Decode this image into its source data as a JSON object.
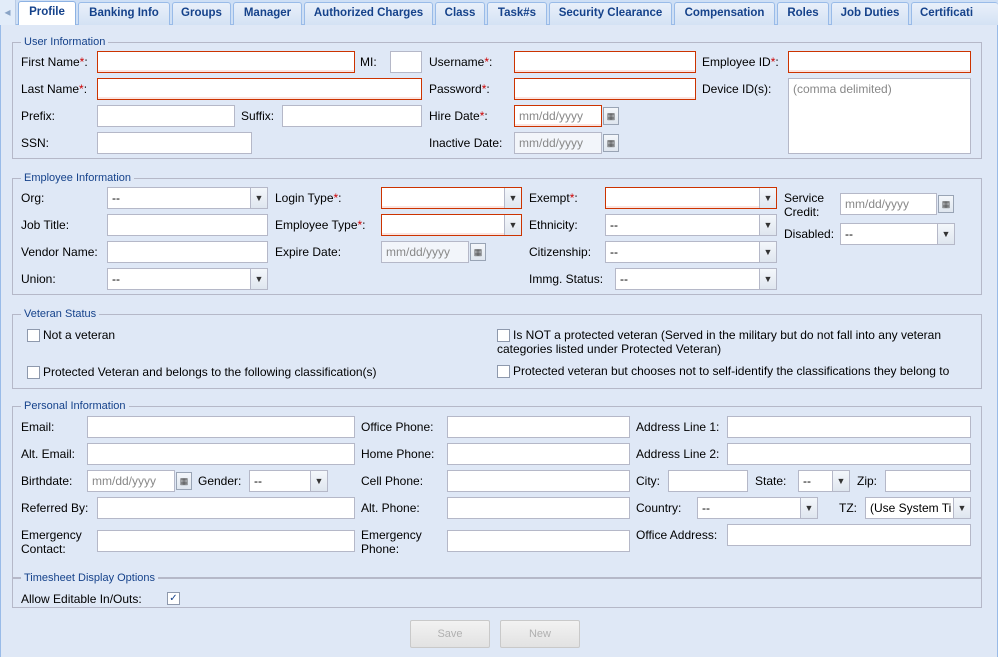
{
  "tabs": [
    "Profile",
    "Banking Info",
    "Groups",
    "Manager",
    "Authorized Charges",
    "Class",
    "Task#s",
    "Security Clearance",
    "Compensation",
    "Roles",
    "Job Duties",
    "Certificati"
  ],
  "user_info": {
    "legend": "User Information",
    "first_name": "First Name",
    "mi": "MI:",
    "username": "Username",
    "employee_id": "Employee ID",
    "last_name": "Last Name",
    "password": "Password",
    "device_ids": "Device ID(s):",
    "device_ids_placeholder": "(comma delimited)",
    "prefix": "Prefix:",
    "suffix": "Suffix:",
    "hire_date": "Hire Date",
    "ssn": "SSN:",
    "inactive_date": "Inactive Date:",
    "date_placeholder": "mm/dd/yyyy"
  },
  "employee_info": {
    "legend": "Employee Information",
    "org": "Org:",
    "org_value": "--",
    "login_type": "Login Type",
    "exempt": "Exempt",
    "service_credit_1": "Service",
    "service_credit_2": "Credit:",
    "job_title": "Job Title:",
    "employee_type": "Employee Type",
    "ethnicity": "Ethnicity:",
    "ethnicity_value": "--",
    "disabled": "Disabled:",
    "disabled_value": "--",
    "vendor_name": "Vendor Name:",
    "expire_date": "Expire Date:",
    "citizenship": "Citizenship:",
    "citizenship_value": "--",
    "union": "Union:",
    "union_value": "--",
    "immg_status": "Immg. Status:",
    "immg_value": "--"
  },
  "veteran": {
    "legend": "Veteran Status",
    "not_veteran": "Not a veteran",
    "not_protected_1": "Is NOT a protected veteran (Served in the military but do not fall into any veteran",
    "not_protected_2": "categories listed under Protected Veteran)",
    "protected_class": "Protected Veteran and belongs to the following classification(s)",
    "protected_no_self_id": "Protected veteran but chooses not to self-identify the classifications they belong to"
  },
  "personal": {
    "legend": "Personal Information",
    "email": "Email:",
    "office_phone": "Office Phone:",
    "address1": "Address Line 1:",
    "alt_email": "Alt. Email:",
    "home_phone": "Home Phone:",
    "address2": "Address Line 2:",
    "birthdate": "Birthdate:",
    "gender": "Gender:",
    "gender_value": "--",
    "cell_phone": "Cell Phone:",
    "city": "City:",
    "state": "State:",
    "state_value": "--",
    "zip": "Zip:",
    "referred_by": "Referred By:",
    "alt_phone": "Alt. Phone:",
    "country": "Country:",
    "country_value": "--",
    "tz": "TZ:",
    "tz_value": "(Use System Ti",
    "emergency_contact_1": "Emergency",
    "emergency_contact_2": "Contact:",
    "emergency_phone_1": "Emergency",
    "emergency_phone_2": "Phone:",
    "office_address": "Office Address:"
  },
  "timesheet": {
    "legend": "Timesheet Display Options",
    "allow_editable": "Allow Editable In/Outs:",
    "allow_editable_checked": "✓"
  },
  "buttons": {
    "save": "Save",
    "new": "New"
  },
  "icons": {
    "combo_arrow": "▼",
    "calendar": "▦",
    "tab_scroll_left": "◂"
  }
}
